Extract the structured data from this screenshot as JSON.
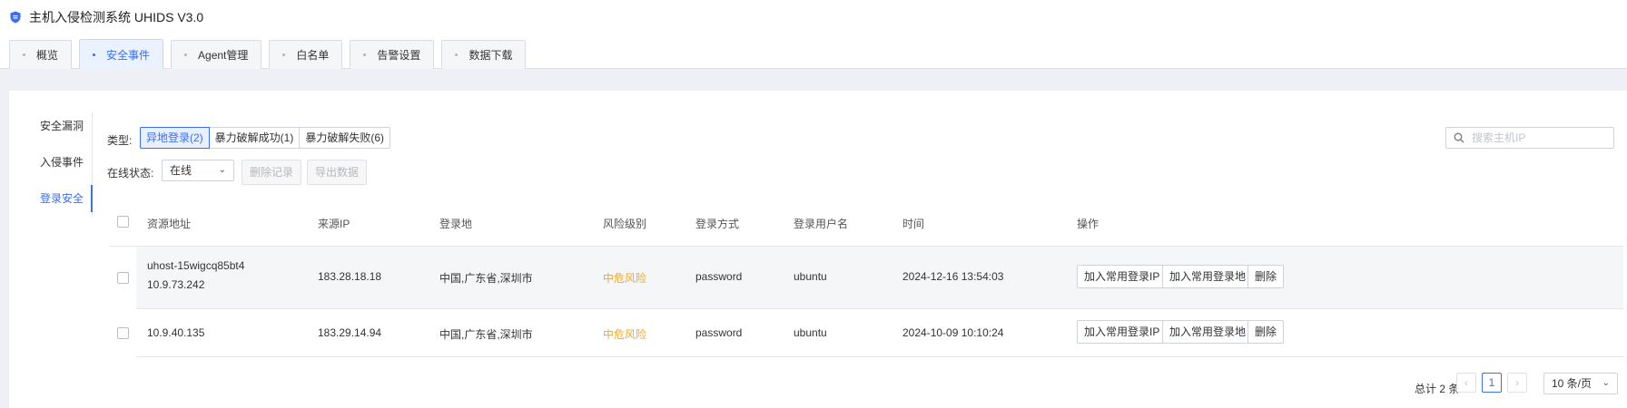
{
  "app": {
    "title": "主机入侵检测系统 UHIDS V3.0",
    "logo_icon": "shield-icon",
    "accent": "#3b6ef5"
  },
  "tabs": [
    {
      "label": "概览",
      "active": false
    },
    {
      "label": "安全事件",
      "active": true
    },
    {
      "label": "Agent管理",
      "active": false
    },
    {
      "label": "白名单",
      "active": false
    },
    {
      "label": "告警设置",
      "active": false
    },
    {
      "label": "数据下载",
      "active": false
    }
  ],
  "sidenav": [
    {
      "label": "安全漏洞",
      "active": false
    },
    {
      "label": "入侵事件",
      "active": false
    },
    {
      "label": "登录安全",
      "active": true
    }
  ],
  "filters": {
    "type_label": "类型:",
    "type_options": [
      "异地登录(2)",
      "暴力破解成功(1)",
      "暴力破解失败(6)"
    ],
    "type_selected": "异地登录(2)",
    "status_label": "在线状态:",
    "status_value": "在线",
    "delete_records": "删除记录",
    "export_data": "导出数据"
  },
  "search": {
    "placeholder": "搜索主机IP",
    "value": ""
  },
  "table": {
    "columns": [
      "资源地址",
      "来源IP",
      "登录地",
      "风险级别",
      "登录方式",
      "登录用户名",
      "时间",
      "操作"
    ],
    "rows": [
      {
        "resource_name": "uhost-15wigcq85bt4",
        "resource_ip": "10.9.73.242",
        "source_ip": "183.28.18.18",
        "location": "中国,广东省,深圳市",
        "risk": "中危风险",
        "method": "password",
        "user": "ubuntu",
        "time": "2024-12-16 13:54:03"
      },
      {
        "resource_name": "",
        "resource_ip": "10.9.40.135",
        "source_ip": "183.29.14.94",
        "location": "中国,广东省,深圳市",
        "risk": "中危风险",
        "method": "password",
        "user": "ubuntu",
        "time": "2024-10-09 10:10:24"
      }
    ],
    "actions": {
      "add_ip": "加入常用登录IP",
      "add_location": "加入常用登录地",
      "delete": "删除"
    }
  },
  "pagination": {
    "total": "总计 2 条",
    "prev": "‹",
    "current_page": "1",
    "next": "›",
    "page_size": "10 条/页"
  },
  "colors": {
    "risk_medium": "#f5a623",
    "accent": "#3b6ef5"
  }
}
